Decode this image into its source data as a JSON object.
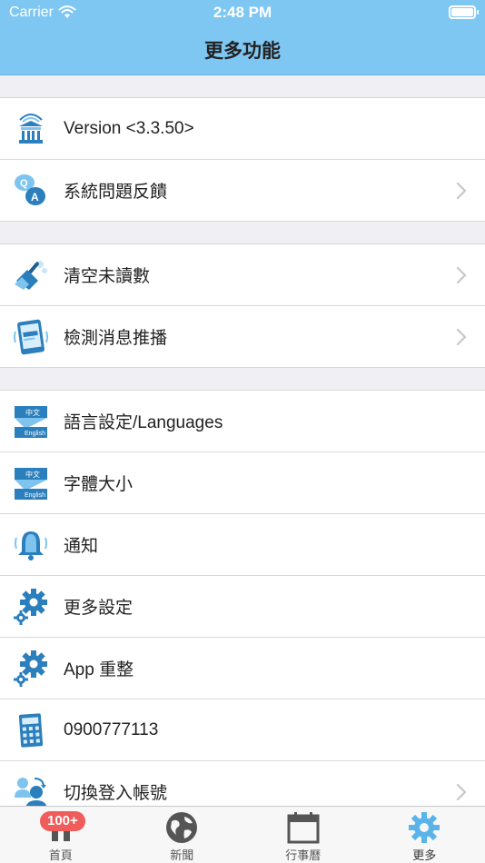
{
  "status_bar": {
    "carrier": "Carrier",
    "time": "2:48 PM",
    "battery_level": 1.0
  },
  "nav": {
    "title": "更多功能"
  },
  "groups": [
    [
      {
        "label": "Version <3.3.50>",
        "icon": "school-building-icon",
        "chevron": false
      },
      {
        "label": "系統問題反饋",
        "icon": "qa-chat-icon",
        "chevron": true
      }
    ],
    [
      {
        "label": "清空未讀數",
        "icon": "broom-icon",
        "chevron": true
      },
      {
        "label": "檢測消息推播",
        "icon": "tablet-icon",
        "chevron": true
      }
    ],
    [
      {
        "label": "語言設定/Languages",
        "icon": "language-icon",
        "chevron": false
      },
      {
        "label": "字體大小",
        "icon": "language-icon",
        "chevron": false
      },
      {
        "label": "通知",
        "icon": "bell-icon",
        "chevron": false
      },
      {
        "label": "更多設定",
        "icon": "gears-icon",
        "chevron": false
      },
      {
        "label": "App 重整",
        "icon": "gears-icon",
        "chevron": false
      },
      {
        "label": "0900777113",
        "icon": "calculator-icon",
        "chevron": false
      },
      {
        "label": "切換登入帳號",
        "icon": "switch-user-icon",
        "chevron": true
      }
    ]
  ],
  "lang_icon_text": {
    "top": "中文",
    "bottom": "English"
  },
  "tabbar": {
    "badge": "100+",
    "tabs": [
      {
        "label": "首頁",
        "icon": "home-icon"
      },
      {
        "label": "新聞",
        "icon": "globe-icon"
      },
      {
        "label": "行事曆",
        "icon": "calendar-icon"
      },
      {
        "label": "更多",
        "icon": "gear-icon"
      }
    ]
  },
  "colors": {
    "nav_bar": "#7fc7f3",
    "icon_blue": "#2b7fbd",
    "badge": "#f05b5b",
    "tab_active": "#5ab4ea"
  }
}
